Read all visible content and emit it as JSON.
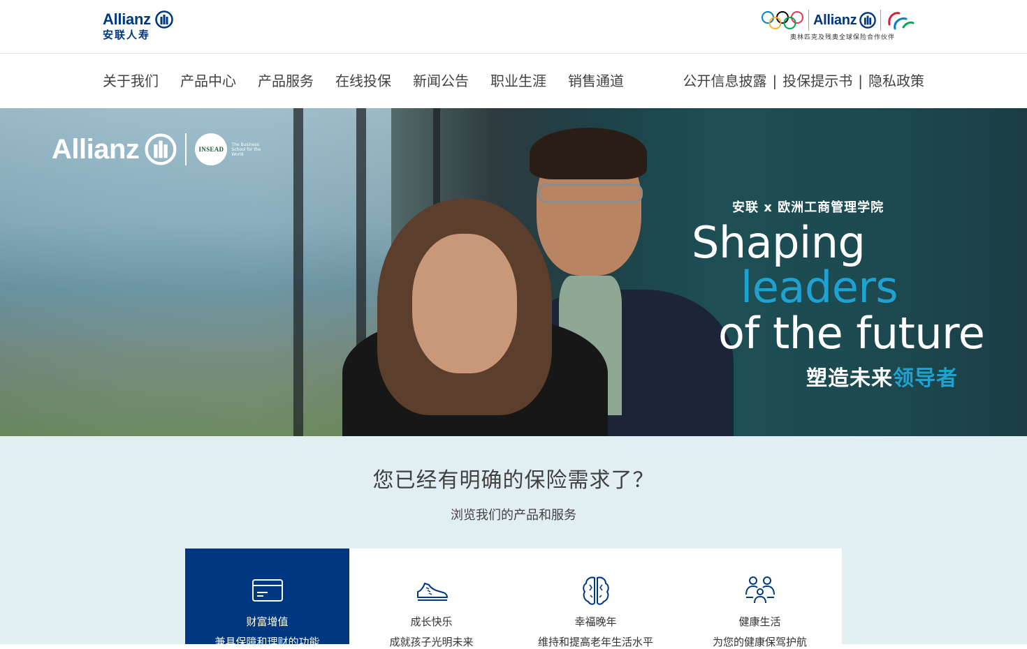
{
  "header": {
    "logo": {
      "brand": "Allianz",
      "sub": "安联人寿"
    },
    "partner": {
      "brand": "Allianz",
      "caption": "奥林匹克及残奥全球保险合作伙伴"
    }
  },
  "nav": {
    "items": [
      {
        "label": "关于我们"
      },
      {
        "label": "产品中心"
      },
      {
        "label": "产品服务"
      },
      {
        "label": "在线投保"
      },
      {
        "label": "新闻公告"
      },
      {
        "label": "职业生涯"
      },
      {
        "label": "销售通道"
      }
    ],
    "right_links": [
      {
        "label": "公开信息披露"
      },
      {
        "label": "投保提示书"
      },
      {
        "label": "隐私政策"
      }
    ],
    "separator": "|"
  },
  "hero": {
    "logo_brand": "Allianz",
    "partner_logo": "INSEAD",
    "partner_tagline": "The Business School for the World",
    "collab": "安联 x 欧洲工商管理学院",
    "line1": "Shaping",
    "line2": "leaders",
    "line3": "of the future",
    "cn_slogan_main": "塑造未来",
    "cn_slogan_highlight": "领导者"
  },
  "needs": {
    "title": "您已经有明确的保险需求了？",
    "subtitle": "浏览我们的产品和服务",
    "cards": [
      {
        "icon": "card-icon",
        "title": "财富增值",
        "desc": "兼具保障和理财的功能",
        "active": true
      },
      {
        "icon": "sneaker-icon",
        "title": "成长快乐",
        "desc": "成就孩子光明未来",
        "active": false
      },
      {
        "icon": "brain-icon",
        "title": "幸福晚年",
        "desc": "维持和提高老年生活水平",
        "active": false
      },
      {
        "icon": "family-icon",
        "title": "健康生活",
        "desc": "为您的健康保驾护航",
        "active": false
      }
    ]
  },
  "colors": {
    "brand_blue": "#003781",
    "accent_cyan": "#1fa2d2",
    "section_bg": "#e1eff3"
  }
}
